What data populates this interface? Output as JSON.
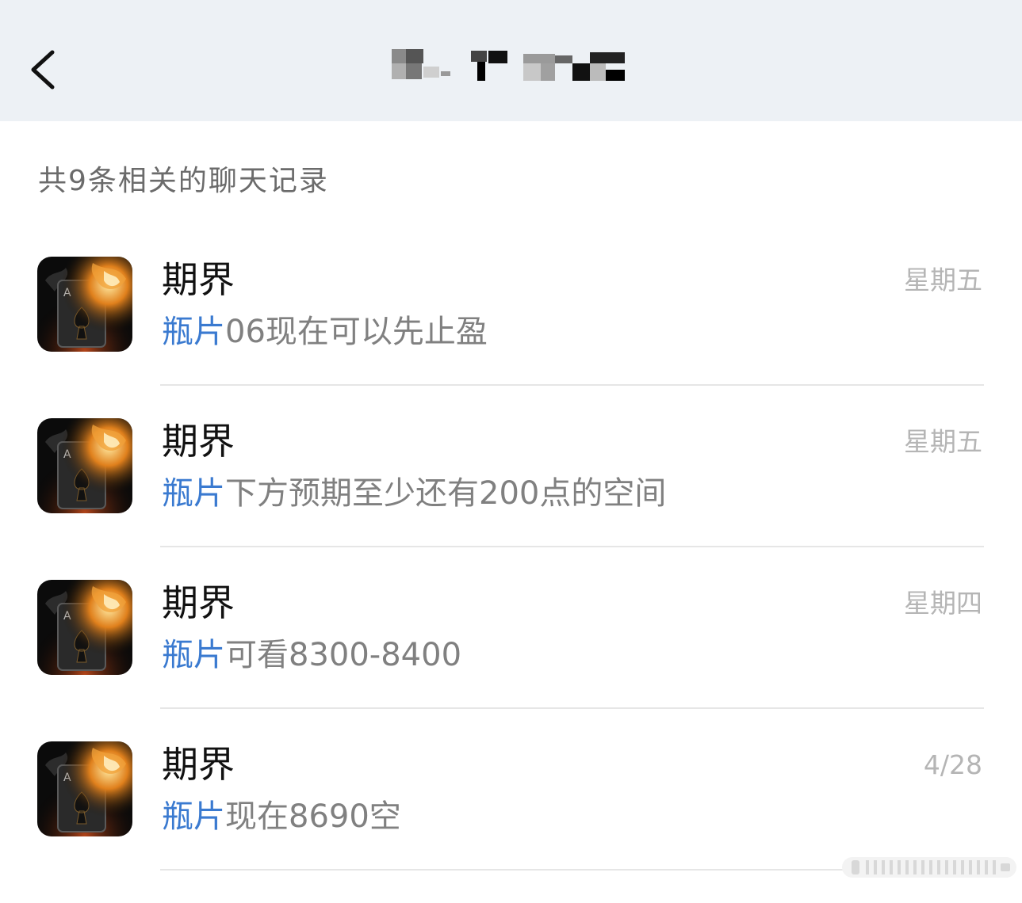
{
  "header": {
    "back_icon": "chevron-left-icon",
    "title": ""
  },
  "summary": "共9条相关的聊天记录",
  "results": [
    {
      "name": "期界",
      "time": "星期五",
      "keyword": "瓶片",
      "text": "06现在可以先止盈"
    },
    {
      "name": "期界",
      "time": "星期五",
      "keyword": "瓶片",
      "text": "下方预期至少还有200点的空间"
    },
    {
      "name": "期界",
      "time": "星期四",
      "keyword": "瓶片",
      "text": "可看8300-8400"
    },
    {
      "name": "期界",
      "time": "4/28",
      "keyword": "瓶片",
      "text": "现在8690空"
    }
  ],
  "colors": {
    "header_bg": "#edf1f5",
    "keyword": "#3a7ad0",
    "message_text": "#808080",
    "time_text": "#b5b5b5",
    "summary_text": "#6b6b6b"
  }
}
